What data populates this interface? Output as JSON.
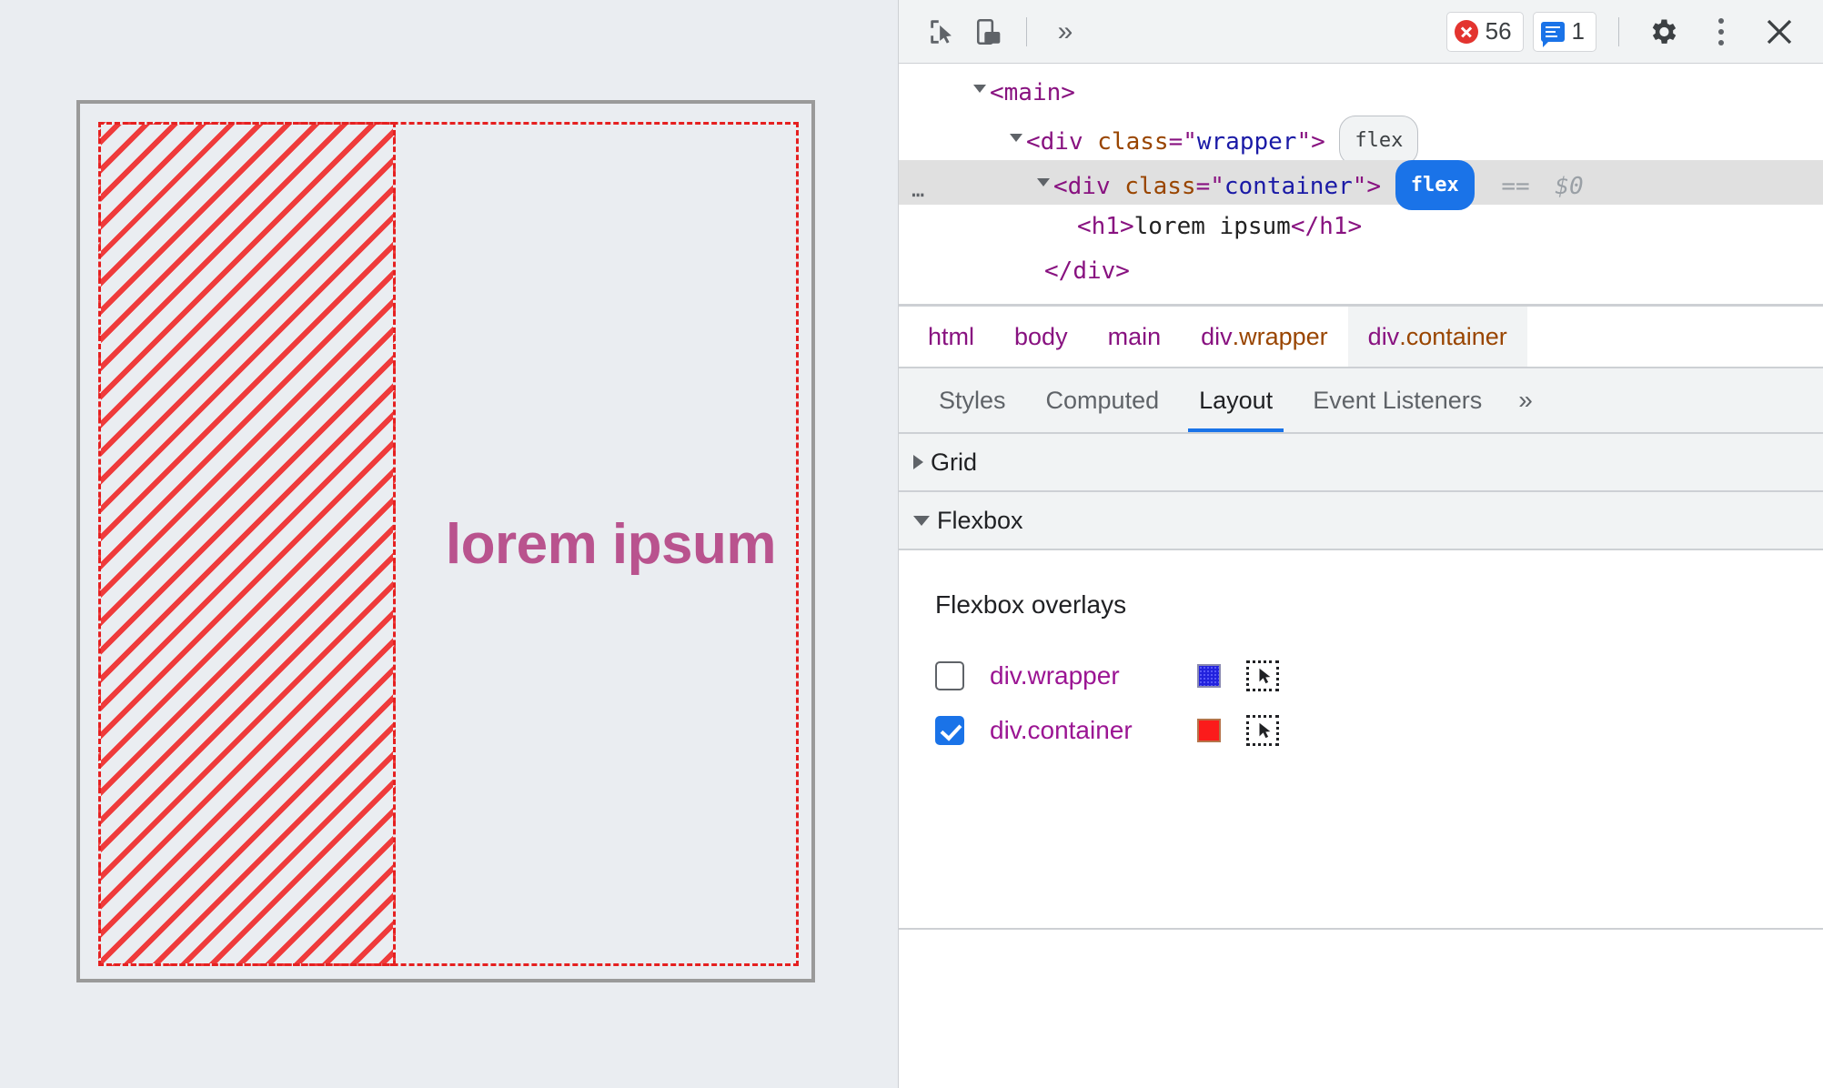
{
  "viewport": {
    "heading": "lorem ipsum",
    "heading_color": "#b9538e",
    "overlay_color": "#e52020",
    "page_background": "#eaedf1"
  },
  "devtools": {
    "toolbar": {
      "inspect_icon": "inspect-cursor-icon",
      "device_icon": "device-toggle-icon",
      "more_panels_label": "»",
      "errors_count": "56",
      "messages_count": "1",
      "settings_icon": "gear-icon",
      "menu_icon": "kebab-menu-icon",
      "close_icon": "close-icon"
    },
    "dom": {
      "rows": [
        {
          "indent": 0,
          "caret": "open",
          "text": "<main>",
          "kind": "tag"
        },
        {
          "indent": 1,
          "caret": "open",
          "text": "<div class=\"wrapper\">",
          "badge": "flex",
          "badge_on": false
        },
        {
          "indent": 2,
          "caret": "open",
          "text": "<div class=\"container\">",
          "badge": "flex",
          "badge_on": true,
          "eq": "==",
          "ref": "$0",
          "selected": true
        },
        {
          "indent": 3,
          "caret": "none",
          "text": "<h1>lorem ipsum</h1>"
        },
        {
          "indent": 2,
          "caret": "none",
          "text": "</div>"
        },
        {
          "indent": 1,
          "caret": "none",
          "text": "</div>"
        }
      ],
      "tag_main": "main",
      "tag_div": "div",
      "attr_class": "class",
      "val_wrapper": "wrapper",
      "val_container": "container",
      "tag_h1": "h1",
      "h1_text": "lorem ipsum",
      "badge_flex": "flex",
      "equals": "==",
      "dollar_ref": "$0"
    },
    "breadcrumb": [
      {
        "tag": "html",
        "cls": "",
        "active": false
      },
      {
        "tag": "body",
        "cls": "",
        "active": false
      },
      {
        "tag": "main",
        "cls": "",
        "active": false
      },
      {
        "tag": "div",
        "cls": ".wrapper",
        "active": false
      },
      {
        "tag": "div",
        "cls": ".container",
        "active": true
      }
    ],
    "tabs": [
      {
        "label": "Styles",
        "active": false
      },
      {
        "label": "Computed",
        "active": false
      },
      {
        "label": "Layout",
        "active": true
      },
      {
        "label": "Event Listeners",
        "active": false
      }
    ],
    "tabs_overflow": "»",
    "sections": {
      "grid": {
        "label": "Grid",
        "expanded": false
      },
      "flexbox": {
        "label": "Flexbox",
        "expanded": true
      }
    },
    "flexbox_panel": {
      "title": "Flexbox overlays",
      "overlays": [
        {
          "label": "div.wrapper",
          "checked": false,
          "color": "#2222dd",
          "picker_icon": "element-picker-icon"
        },
        {
          "label": "div.container",
          "checked": true,
          "color": "#fb1b1b",
          "picker_icon": "element-picker-icon"
        }
      ]
    }
  }
}
